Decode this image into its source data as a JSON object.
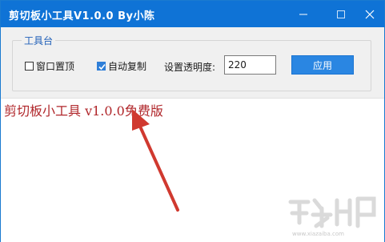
{
  "window": {
    "title": "剪切板小工具V1.0.0  By小陈",
    "minimize_icon": "minimize-icon",
    "maximize_icon": "maximize-icon",
    "close_icon": "close-icon"
  },
  "toolbox": {
    "group_label": "工具台",
    "pin_top": {
      "label": "窗口置顶",
      "checked": false
    },
    "auto_copy": {
      "label": "自动复制",
      "checked": true
    },
    "opacity_label": "设置透明度:",
    "opacity_value": "220",
    "apply_label": "应用"
  },
  "content": {
    "text": "剪切板小工具 v1.0.0免费版"
  },
  "colors": {
    "titlebar": "#0f73d6",
    "content_text": "#b0262a",
    "arrow": "#d0392f",
    "apply_button": "#2a86e2"
  }
}
